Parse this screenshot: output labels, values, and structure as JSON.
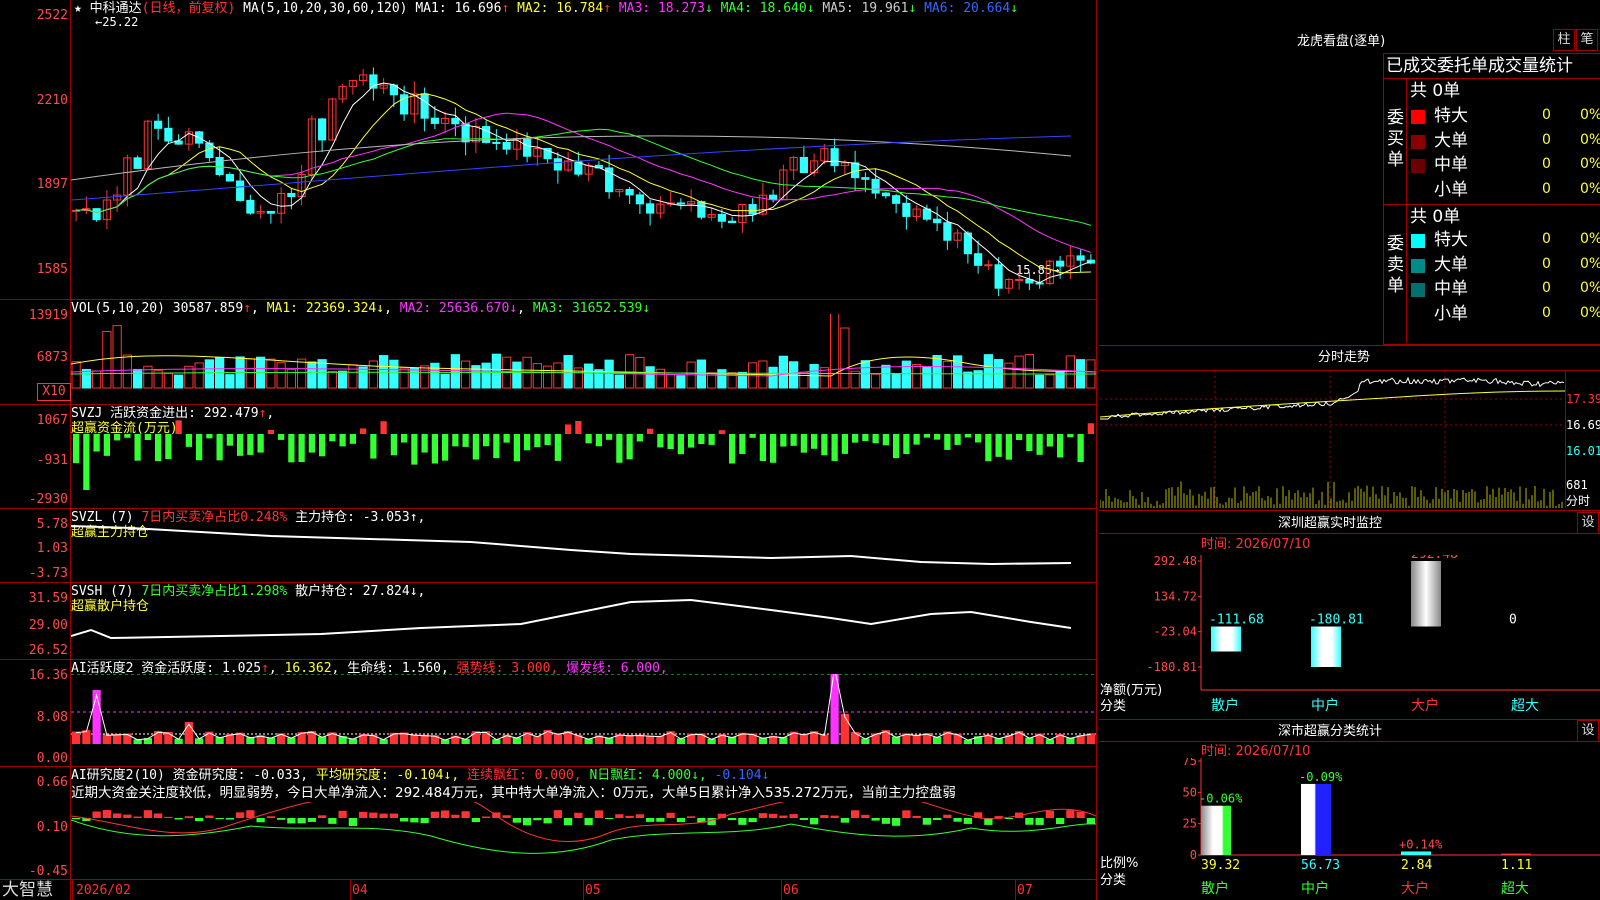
{
  "kline": {
    "title": "★ 中科通达",
    "qualifier": "(日线，前复权)",
    "ma_header": "MA(5,10,20,30,60,120)",
    "mas": [
      {
        "label": "MA1: 16.696",
        "arrow": "↑",
        "color": "#ffffff"
      },
      {
        "label": "MA2: 16.784",
        "arrow": "↑",
        "color": "#ffff33"
      },
      {
        "label": "MA3: 18.273",
        "arrow": "↓",
        "color": "#ff33ff"
      },
      {
        "label": "MA4: 18.640",
        "arrow": "↓",
        "color": "#33ff33"
      },
      {
        "label": "MA5: 19.961",
        "arrow": "↓",
        "color": "#cccccc"
      },
      {
        "label": "MA6: 20.664",
        "arrow": "↓",
        "color": "#3366ff"
      }
    ],
    "axis": [
      "2522",
      "2210",
      "1897",
      "1585"
    ],
    "high_label": "←25.22",
    "low_label": "15.85→"
  },
  "vol": {
    "header": "VOL(5,10,20)",
    "value": "30587.859",
    "value_arrow": "↑",
    "ma1": "MA1: 22369.324↓",
    "ma2": "MA2: 25636.670↓",
    "ma3": "MA3: 31652.539↓",
    "axis": [
      "13919",
      "6873"
    ],
    "unit": "X10"
  },
  "svzj": {
    "header": "SVZJ  活跃资金进出: 292.479",
    "arrow": "↑",
    "sub": "超赢资金流(万元)",
    "axis": [
      "1067",
      "-931",
      "-2930"
    ]
  },
  "svzl": {
    "header": "SVZL (7)",
    "ratio": "7日内买卖净占比0.248%",
    "hold": "主力持仓: -3.053↑,",
    "sub": "超赢主力持仓",
    "axis": [
      "5.78",
      "1.03",
      "-3.73"
    ]
  },
  "svsh": {
    "header": "SVSH (7)",
    "ratio": "7日内买卖净占比1.298%",
    "hold": "散户持仓: 27.824↓,",
    "sub": "超赢散户持仓",
    "axis": [
      "31.59",
      "29.00",
      "26.52"
    ]
  },
  "ai1": {
    "header": "AI活跃度2 资金活跃度: 1.025",
    "a1": "↑",
    "v2": "16.362",
    "life": "生命线: 1.560,",
    "strong": "强势线: 3.000,",
    "burst": "爆发线: 6.000,",
    "axis": [
      "16.36",
      "8.08",
      "0.00"
    ]
  },
  "ai2": {
    "header": "AI研究度2(10) 资金研究度: -0.033",
    "avg": "平均研究度: -0.104↓,",
    "red1": "连续飘红: 0.000,",
    "red2": "N日飘红: 4.000↓,",
    "tail": "-0.104↓",
    "comment": "近期大资金关注度较低，明显弱势，今日大单净流入：292.484万元，其中特大单净流入：0万元，大单5日累计净入535.272万元，当前主力控盘弱",
    "axis": [
      "0.66",
      "0.10",
      "-0.45"
    ]
  },
  "date_axis": [
    "2026/02",
    "04",
    "05",
    "06",
    "07"
  ],
  "logo": "大智慧",
  "dragon": {
    "title": "龙虎看盘(逐单)",
    "btn_a": "柱",
    "btn_b": "笔",
    "header": "已成交委托单成交量统计",
    "buy_label": "委买单",
    "sell_label": "委卖单",
    "buy_total": "共 0单",
    "sell_total": "共 0单",
    "buy_rows": [
      {
        "name": "特大",
        "n": "0",
        "p": "0%",
        "c": "#ff0000"
      },
      {
        "name": "大单",
        "n": "0",
        "p": "0%",
        "c": "#8b0000"
      },
      {
        "name": "中单",
        "n": "0",
        "p": "0%",
        "c": "#6b0000"
      },
      {
        "name": "小单",
        "n": "0",
        "p": "0%",
        "c": "#000000"
      }
    ],
    "sell_rows": [
      {
        "name": "特大",
        "n": "0",
        "p": "0%",
        "c": "#00ffff"
      },
      {
        "name": "大单",
        "n": "0",
        "p": "0%",
        "c": "#008b8b"
      },
      {
        "name": "中单",
        "n": "0",
        "p": "0%",
        "c": "#007070"
      },
      {
        "name": "小单",
        "n": "0",
        "p": "0%",
        "c": "#000000"
      }
    ]
  },
  "intraday": {
    "title": "分时走势",
    "axis": [
      "17.39",
      "16.69",
      "16.01",
      "681"
    ],
    "foot": "分时"
  },
  "monitor": {
    "title": "深圳超赢实时监控",
    "set": "设",
    "time": "时间: 2026/07/10",
    "ylabels": [
      "292.48",
      "134.72",
      "-23.04",
      "-180.81"
    ],
    "ytitle": "净额(万元)",
    "xtitle": "分类",
    "cats": [
      "散户",
      "中户",
      "大户",
      "超大"
    ],
    "values_text": [
      "-111.68",
      "-180.81",
      "292.48",
      "0"
    ]
  },
  "classify": {
    "title": "深市超赢分类统计",
    "set": "设",
    "time": "时间: 2026/07/10",
    "ylabels": [
      "75",
      "50",
      "25",
      "0"
    ],
    "ytitle": "比例%",
    "xtitle": "分类",
    "cats": [
      "散户",
      "中户",
      "大户",
      "超大"
    ],
    "bar_vals": [
      "39.32",
      "56.73",
      "2.84",
      "1.11"
    ],
    "chg": [
      "-0.06%",
      "-0.09%",
      "+0.14%",
      ""
    ]
  },
  "chart_data": [
    {
      "type": "bar",
      "title": "深圳超赢实时监控",
      "ylabel": "净额(万元)",
      "xlabel": "分类",
      "categories": [
        "散户",
        "中户",
        "大户",
        "超大"
      ],
      "values": [
        -111.68,
        -180.81,
        292.48,
        0
      ],
      "ylim": [
        -180.81,
        292.48
      ]
    },
    {
      "type": "bar",
      "title": "深市超赢分类统计",
      "ylabel": "比例%",
      "xlabel": "分类",
      "categories": [
        "散户",
        "中户",
        "大户",
        "超大"
      ],
      "values": [
        39.32,
        56.73,
        2.84,
        1.11
      ],
      "ylim": [
        0,
        75
      ]
    }
  ]
}
